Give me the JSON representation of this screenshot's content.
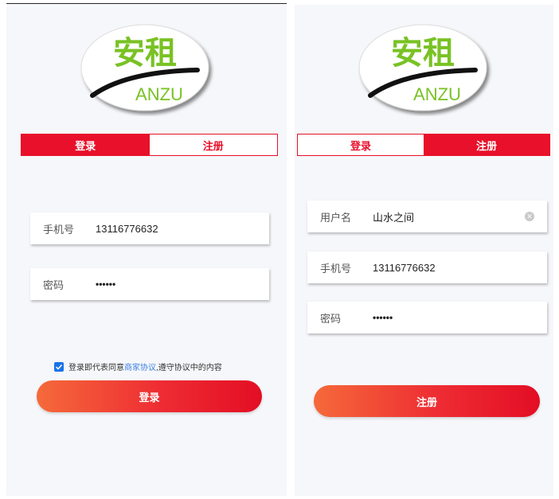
{
  "brand": {
    "logo_cn": "安租",
    "logo_en": "ANZU"
  },
  "colors": {
    "accent": "#e8102a",
    "logo_green": "#79c224",
    "button_gradient": [
      "#f56a3a",
      "#e30e24"
    ],
    "link": "#3b7fe6",
    "checkbox": "#1a73e8"
  },
  "login": {
    "tabs": [
      {
        "label": "登录",
        "active": true
      },
      {
        "label": "注册",
        "active": false
      }
    ],
    "phone": {
      "label": "手机号",
      "value": "13116776632"
    },
    "password": {
      "label": "密码",
      "value": "••••••"
    },
    "agreement": {
      "checked": true,
      "prefix": "登录即代表同意",
      "link": "商家协议",
      "suffix": ",遵守协议中的内容"
    },
    "submit_label": "登录"
  },
  "register": {
    "tabs": [
      {
        "label": "登录",
        "active": false
      },
      {
        "label": "注册",
        "active": true
      }
    ],
    "username": {
      "label": "用户名",
      "value": "山水之间"
    },
    "phone": {
      "label": "手机号",
      "value": "13116776632"
    },
    "password": {
      "label": "密码",
      "value": "••••••"
    },
    "submit_label": "注册"
  }
}
